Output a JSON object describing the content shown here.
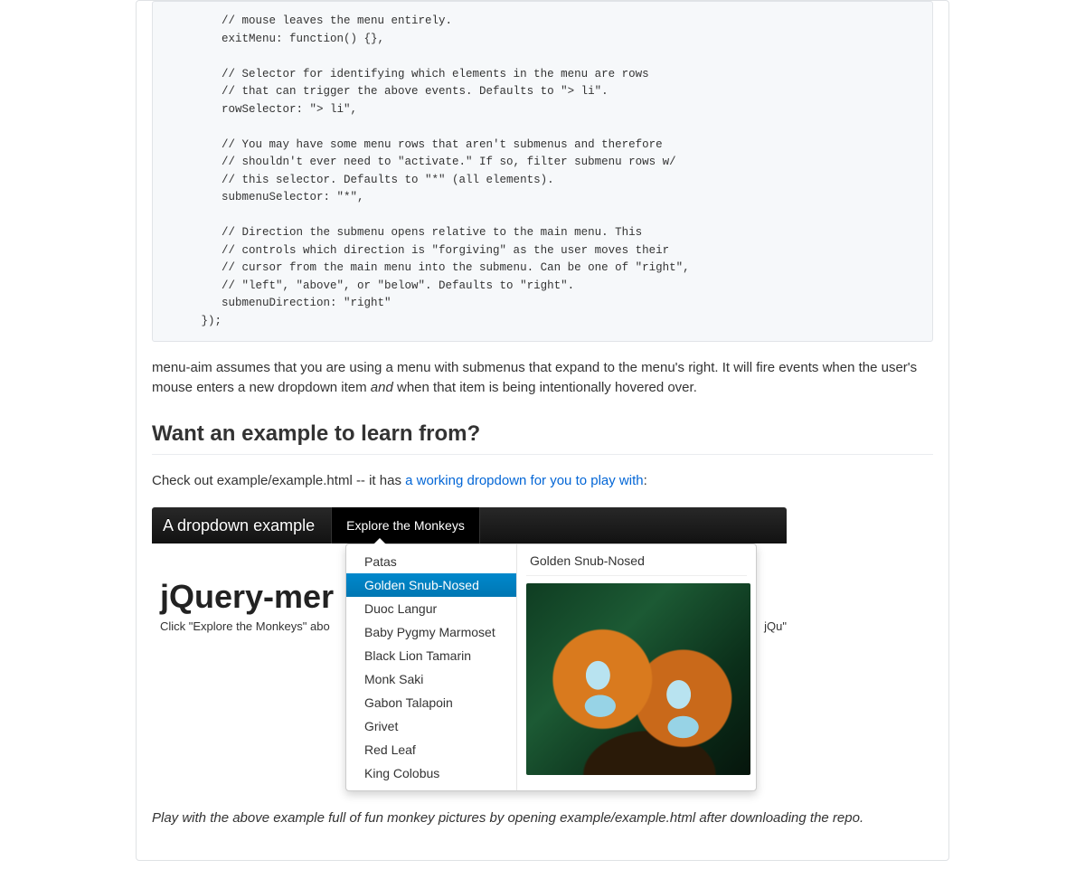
{
  "code_block": "        // mouse leaves the menu entirely.\n        exitMenu: function() {},\n\n        // Selector for identifying which elements in the menu are rows\n        // that can trigger the above events. Defaults to \"> li\".\n        rowSelector: \"> li\",\n\n        // You may have some menu rows that aren't submenus and therefore\n        // shouldn't ever need to \"activate.\" If so, filter submenu rows w/\n        // this selector. Defaults to \"*\" (all elements).\n        submenuSelector: \"*\",\n\n        // Direction the submenu opens relative to the main menu. This\n        // controls which direction is \"forgiving\" as the user moves their\n        // cursor from the main menu into the submenu. Can be one of \"right\",\n        // \"left\", \"above\", or \"below\". Defaults to \"right\".\n        submenuDirection: \"right\"\n     });",
  "para1": {
    "before": "menu-aim assumes that you are using a menu with submenus that expand to the menu's right. It will fire events when the user's mouse enters a new dropdown item ",
    "em": "and",
    "after": " when that item is being intentionally hovered over."
  },
  "heading": "Want an example to learn from?",
  "para2": {
    "before": "Check out example/example.html -- it has ",
    "link": "a working dropdown for you to play with",
    "after": ":"
  },
  "example": {
    "nav_brand": "A dropdown example",
    "nav_item": "Explore the Monkeys",
    "bg_heading": "jQuery-mer",
    "bg_text": "Click \"Explore the Monkeys\" abo",
    "bg_text_right": "\"jQu",
    "menu_items": [
      "Patas",
      "Golden Snub-Nosed",
      "Duoc Langur",
      "Baby Pygmy Marmoset",
      "Black Lion Tamarin",
      "Monk Saki",
      "Gabon Talapoin",
      "Grivet",
      "Red Leaf",
      "King Colobus"
    ],
    "active_index": 1,
    "panel_title": "Golden Snub-Nosed"
  },
  "caption": "Play with the above example full of fun monkey pictures by opening example/example.html after downloading the repo."
}
